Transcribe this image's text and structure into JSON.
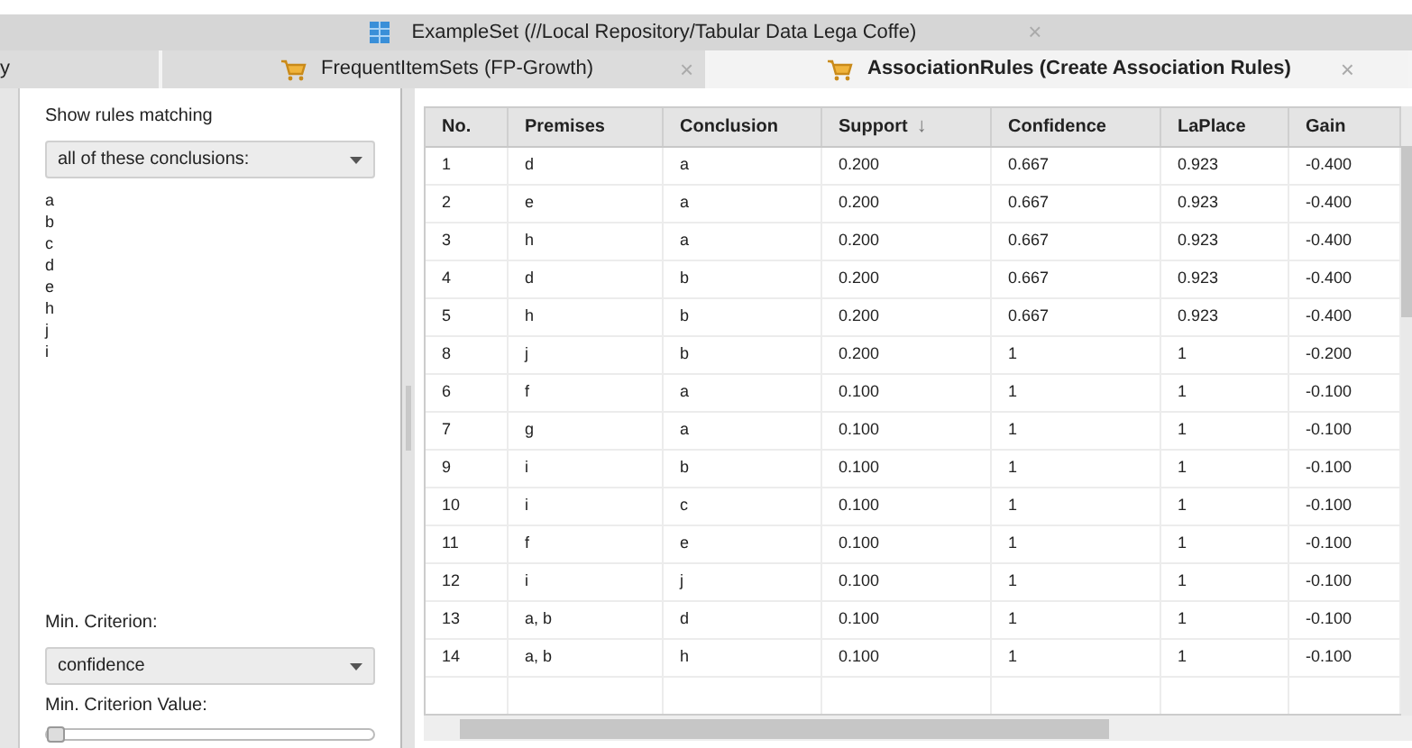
{
  "top_tab": {
    "title": "ExampleSet (//Local Repository/Tabular Data Lega Coffe)",
    "close": "×"
  },
  "tabs": [
    {
      "label": "y",
      "selected": false,
      "kind": "plain"
    },
    {
      "label": "FrequentItemSets (FP-Growth)",
      "selected": false,
      "kind": "cart",
      "close": "×"
    },
    {
      "label": "AssociationRules (Create Association Rules)",
      "selected": true,
      "kind": "cart",
      "close": "×"
    }
  ],
  "filter": {
    "label": "Show rules matching",
    "mode": "all of these conclusions:",
    "items": [
      "a",
      "b",
      "c",
      "d",
      "e",
      "h",
      "j",
      "i"
    ],
    "criterion_label": "Min. Criterion:",
    "criterion": "confidence",
    "value_label": "Min. Criterion Value:",
    "slider": {
      "level": 0
    }
  },
  "table": {
    "columns": [
      {
        "label": "No."
      },
      {
        "label": "Premises"
      },
      {
        "label": "Conclusion"
      },
      {
        "label": "Support",
        "sort": "↓"
      },
      {
        "label": "Confidence"
      },
      {
        "label": "LaPlace"
      },
      {
        "label": "Gain"
      }
    ],
    "rows": [
      [
        "1",
        "d",
        "a",
        "0.200",
        "0.667",
        "0.923",
        "-0.400"
      ],
      [
        "2",
        "e",
        "a",
        "0.200",
        "0.667",
        "0.923",
        "-0.400"
      ],
      [
        "3",
        "h",
        "a",
        "0.200",
        "0.667",
        "0.923",
        "-0.400"
      ],
      [
        "4",
        "d",
        "b",
        "0.200",
        "0.667",
        "0.923",
        "-0.400"
      ],
      [
        "5",
        "h",
        "b",
        "0.200",
        "0.667",
        "0.923",
        "-0.400"
      ],
      [
        "8",
        "j",
        "b",
        "0.200",
        "1",
        "1",
        "-0.200"
      ],
      [
        "6",
        "f",
        "a",
        "0.100",
        "1",
        "1",
        "-0.100"
      ],
      [
        "7",
        "g",
        "a",
        "0.100",
        "1",
        "1",
        "-0.100"
      ],
      [
        "9",
        "i",
        "b",
        "0.100",
        "1",
        "1",
        "-0.100"
      ],
      [
        "10",
        "i",
        "c",
        "0.100",
        "1",
        "1",
        "-0.100"
      ],
      [
        "11",
        "f",
        "e",
        "0.100",
        "1",
        "1",
        "-0.100"
      ],
      [
        "12",
        "i",
        "j",
        "0.100",
        "1",
        "1",
        "-0.100"
      ],
      [
        "13",
        "a, b",
        "d",
        "0.100",
        "1",
        "1",
        "-0.100"
      ],
      [
        "14",
        "a, b",
        "h",
        "0.100",
        "1",
        "1",
        "-0.100"
      ]
    ]
  }
}
